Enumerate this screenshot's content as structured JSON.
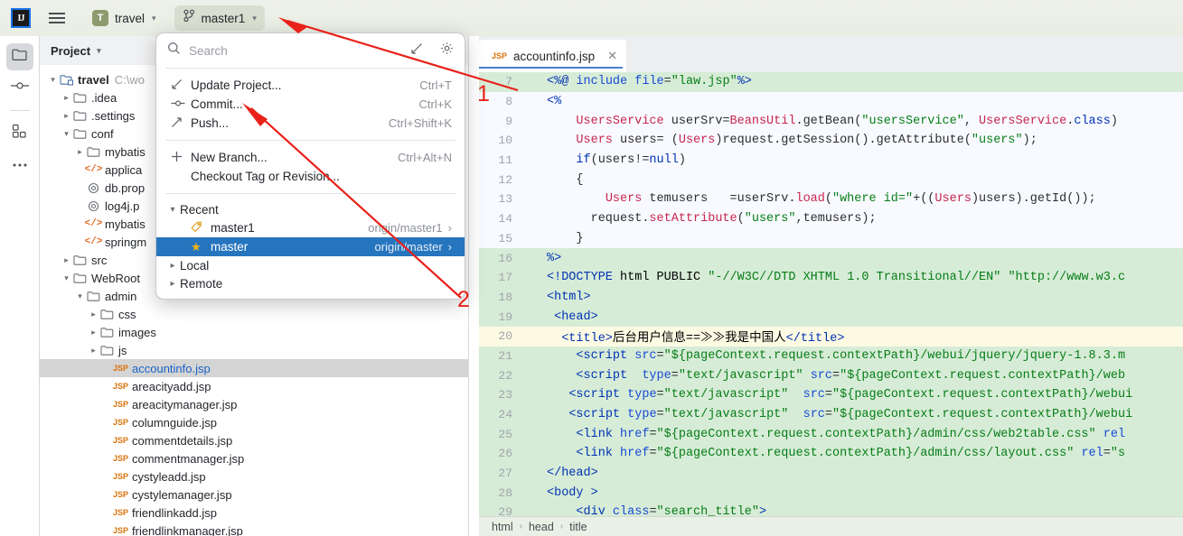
{
  "toolbar": {
    "logo_text": "IJ",
    "logo_icon": "intellij-idea-logo",
    "menu_icon": "hamburger-menu-icon",
    "project_badge": "T",
    "project_name": "travel",
    "branch_icon": "git-branch-icon",
    "branch_name": "master1",
    "chevron": "⌄"
  },
  "activity_bar": {
    "items": [
      {
        "name": "project-tool-window",
        "icon": "folder-icon",
        "selected": true
      },
      {
        "name": "commit-tool-window",
        "icon": "commit-node-icon",
        "selected": false
      },
      {
        "name": "structure-tool-window",
        "icon": "structure-squares-icon",
        "selected": false
      },
      {
        "name": "more-tool-windows",
        "icon": "more-dots-icon",
        "selected": false
      }
    ]
  },
  "project_panel": {
    "title": "Project",
    "title_chevron": "⌄",
    "tree": [
      {
        "indent": 0,
        "arrow": "v",
        "icon": "module-icon",
        "label": "travel",
        "suffix": "C:\\wo",
        "bold": true
      },
      {
        "indent": 1,
        "arrow": ">",
        "icon": "folder-icon",
        "label": ".idea",
        "suffix": ""
      },
      {
        "indent": 1,
        "arrow": ">",
        "icon": "folder-icon",
        "label": ".settings",
        "suffix": ""
      },
      {
        "indent": 1,
        "arrow": "v",
        "icon": "folder-icon",
        "label": "conf",
        "suffix": ""
      },
      {
        "indent": 2,
        "arrow": ">",
        "icon": "folder-icon",
        "label": "mybatis",
        "suffix": ""
      },
      {
        "indent": 2,
        "arrow": "",
        "icon": "xml-icon",
        "label": "applica",
        "suffix": ""
      },
      {
        "indent": 2,
        "arrow": "",
        "icon": "props-icon",
        "label": "db.prop",
        "suffix": ""
      },
      {
        "indent": 2,
        "arrow": "",
        "icon": "props-icon",
        "label": "log4j.p",
        "suffix": ""
      },
      {
        "indent": 2,
        "arrow": "",
        "icon": "xml-icon",
        "label": "mybatis",
        "suffix": ""
      },
      {
        "indent": 2,
        "arrow": "",
        "icon": "xml-icon",
        "label": "springm",
        "suffix": ""
      },
      {
        "indent": 1,
        "arrow": ">",
        "icon": "folder-icon",
        "label": "src",
        "suffix": ""
      },
      {
        "indent": 1,
        "arrow": "v",
        "icon": "folder-icon",
        "label": "WebRoot",
        "suffix": ""
      },
      {
        "indent": 2,
        "arrow": "v",
        "icon": "folder-icon",
        "label": "admin",
        "suffix": ""
      },
      {
        "indent": 3,
        "arrow": ">",
        "icon": "folder-icon",
        "label": "css",
        "suffix": ""
      },
      {
        "indent": 3,
        "arrow": ">",
        "icon": "folder-icon",
        "label": "images",
        "suffix": ""
      },
      {
        "indent": 3,
        "arrow": ">",
        "icon": "folder-icon",
        "label": "js",
        "suffix": ""
      },
      {
        "indent": 4,
        "arrow": "",
        "icon": "jsp-icon",
        "label": "accountinfo.jsp",
        "suffix": "",
        "selected": true
      },
      {
        "indent": 4,
        "arrow": "",
        "icon": "jsp-icon",
        "label": "areacityadd.jsp",
        "suffix": ""
      },
      {
        "indent": 4,
        "arrow": "",
        "icon": "jsp-icon",
        "label": "areacitymanager.jsp",
        "suffix": ""
      },
      {
        "indent": 4,
        "arrow": "",
        "icon": "jsp-icon",
        "label": "columnguide.jsp",
        "suffix": ""
      },
      {
        "indent": 4,
        "arrow": "",
        "icon": "jsp-icon",
        "label": "commentdetails.jsp",
        "suffix": ""
      },
      {
        "indent": 4,
        "arrow": "",
        "icon": "jsp-icon",
        "label": "commentmanager.jsp",
        "suffix": ""
      },
      {
        "indent": 4,
        "arrow": "",
        "icon": "jsp-icon",
        "label": "cystyleadd.jsp",
        "suffix": ""
      },
      {
        "indent": 4,
        "arrow": "",
        "icon": "jsp-icon",
        "label": "cystylemanager.jsp",
        "suffix": ""
      },
      {
        "indent": 4,
        "arrow": "",
        "icon": "jsp-icon",
        "label": "friendlinkadd.jsp",
        "suffix": ""
      },
      {
        "indent": 4,
        "arrow": "",
        "icon": "jsp-icon",
        "label": "friendlinkmanager.jsp",
        "suffix": ""
      }
    ]
  },
  "branch_popup": {
    "search_icon": "search-icon",
    "search_placeholder": "Search",
    "search_value": "",
    "expand_icon": "expand-arrow-icon",
    "settings_icon": "gear-icon",
    "actions": [
      {
        "icon": "update-project-icon",
        "label": "Update Project...",
        "shortcut": "Ctrl+T"
      },
      {
        "icon": "commit-icon",
        "label": "Commit...",
        "shortcut": "Ctrl+K"
      },
      {
        "icon": "push-icon",
        "label": "Push...",
        "shortcut": "Ctrl+Shift+K"
      }
    ],
    "branch_actions": [
      {
        "icon": "plus-icon",
        "label": "New Branch...",
        "shortcut": "Ctrl+Alt+N"
      },
      {
        "icon": "",
        "label": "Checkout Tag or Revision...",
        "shortcut": ""
      }
    ],
    "recent_group": {
      "arrow": "v",
      "label": "Recent"
    },
    "recent_branches": [
      {
        "icon": "tag-icon",
        "label": "master1",
        "remote": "origin/master1",
        "chevron": "›",
        "selected": false
      },
      {
        "icon": "star-icon",
        "label": "master",
        "remote": "origin/master",
        "chevron": "›",
        "selected": true
      }
    ],
    "groups": [
      {
        "arrow": ">",
        "label": "Local"
      },
      {
        "arrow": ">",
        "label": "Remote"
      }
    ]
  },
  "editor": {
    "tab": {
      "file_type": "JSP",
      "file_name": "accountinfo.jsp",
      "close_icon": "close-icon"
    },
    "breadcrumb": [
      "html",
      "head",
      "title"
    ],
    "breadcrumb_sep": "›",
    "first_line_number": 7,
    "lines": [
      {
        "n": 7,
        "bg": "green",
        "html": "<span class=\"k\">&lt;%@</span> <span class=\"a\">include</span> <span class=\"a\">file</span>=<span class=\"s\">\"law.jsp\"</span><span class=\"k\">%&gt;</span>"
      },
      {
        "n": 8,
        "bg": "white",
        "html": "<span class=\"k\">&lt;%</span>"
      },
      {
        "n": 9,
        "bg": "white",
        "html": "    <span class=\"r\">UsersService</span> userSrv=<span class=\"r\">BeansUtil</span>.getBean(<span class=\"s\">\"usersService\"</span>, <span class=\"r\">UsersService</span>.<span class=\"k\">class</span>)"
      },
      {
        "n": 10,
        "bg": "white",
        "html": "    <span class=\"r\">Users</span> users= (<span class=\"r\">Users</span>)request.getSession().getAttribute(<span class=\"s\">\"users\"</span>);"
      },
      {
        "n": 11,
        "bg": "white",
        "html": "    <span class=\"k\">if</span>(users!=<span class=\"k\">null</span>)"
      },
      {
        "n": 12,
        "bg": "white",
        "html": "    {"
      },
      {
        "n": 13,
        "bg": "white",
        "html": "        <span class=\"r\">Users</span> temusers   =userSrv.<span class=\"r\">load</span>(<span class=\"s\">\"where id=\"</span>+((<span class=\"r\">Users</span>)users).getId());"
      },
      {
        "n": 14,
        "bg": "white",
        "html": "      request.<span class=\"r\">setAttribute</span>(<span class=\"s\">\"users\"</span>,temusers);"
      },
      {
        "n": 15,
        "bg": "white",
        "html": "    }"
      },
      {
        "n": 16,
        "bg": "green",
        "html": "<span class=\"k\">%&gt;</span>"
      },
      {
        "n": 17,
        "bg": "green",
        "html": "<span class=\"k\">&lt;!DOCTYPE</span> <span class=\"t\">html</span> <span class=\"t\">PUBLIC</span> <span class=\"s\">\"-//W3C//DTD XHTML 1.0 Transitional//EN\"</span> <span class=\"s\">\"http://www.w3.c</span>"
      },
      {
        "n": 18,
        "bg": "green",
        "html": "<span class=\"k\">&lt;html&gt;</span>"
      },
      {
        "n": 19,
        "bg": "green",
        "html": " <span class=\"k\">&lt;head&gt;</span>"
      },
      {
        "n": 20,
        "bg": "yellow",
        "html": "  <span class=\"k\">&lt;title&gt;</span><span class=\"t\">后台用户信息==≫≫我是中国人</span><span class=\"k\">&lt;/title&gt;</span>"
      },
      {
        "n": 21,
        "bg": "green",
        "html": "    <span class=\"k\">&lt;script</span> <span class=\"a\">src</span>=<span class=\"s\">\"${pageContext.request.contextPath}</span><span class=\"s\">/webui</span><span class=\"s\">/jquery</span><span class=\"s\">/jquery-1.8.3.m</span>"
      },
      {
        "n": 22,
        "bg": "green",
        "html": "    <span class=\"k\">&lt;script</span>  <span class=\"a\">type</span>=<span class=\"s\">\"text/javascript\"</span> <span class=\"a\">src</span>=<span class=\"s\">\"${pageContext.request.contextPath}</span><span class=\"s\">/web</span>"
      },
      {
        "n": 23,
        "bg": "green",
        "html": "   <span class=\"k\">&lt;script</span> <span class=\"a\">type</span>=<span class=\"s\">\"text/javascript\"</span>  <span class=\"a\">src</span>=<span class=\"s\">\"${pageContext.request.contextPath}</span><span class=\"s\">/webui</span>"
      },
      {
        "n": 24,
        "bg": "green",
        "html": "   <span class=\"k\">&lt;script</span> <span class=\"a\">type</span>=<span class=\"s\">\"text/javascript\"</span>  <span class=\"a\">src</span>=<span class=\"s\">\"${pageContext.request.contextPath}</span><span class=\"s\">/webui</span>"
      },
      {
        "n": 25,
        "bg": "green",
        "html": "    <span class=\"k\">&lt;link</span> <span class=\"a\">href</span>=<span class=\"s\">\"${pageContext.request.contextPath}</span><span class=\"s\">/admin</span><span class=\"s\">/css</span><span class=\"s\">/web2table.css\"</span> <span class=\"a\">rel</span>"
      },
      {
        "n": 26,
        "bg": "green",
        "html": "    <span class=\"k\">&lt;link</span> <span class=\"a\">href</span>=<span class=\"s\">\"${pageContext.request.contextPath}</span><span class=\"s\">/admin</span><span class=\"s\">/css</span><span class=\"s\">/layout.css\"</span> <span class=\"a\">rel</span>=<span class=\"s\">\"s</span>"
      },
      {
        "n": 27,
        "bg": "green",
        "html": "<span class=\"k\">&lt;/head&gt;</span>"
      },
      {
        "n": 28,
        "bg": "green",
        "html": "<span class=\"k\">&lt;body</span> <span class=\"k\">&gt;</span>"
      },
      {
        "n": 29,
        "bg": "green",
        "html": "    <span class=\"k\">&lt;div</span> <span class=\"a\">class</span>=<span class=\"s\">\"search_title\"</span><span class=\"k\">&gt;</span>"
      }
    ]
  },
  "annotations": {
    "arrow_color": "#e8221a",
    "markers": [
      {
        "label": "1"
      },
      {
        "label": "2"
      }
    ]
  }
}
